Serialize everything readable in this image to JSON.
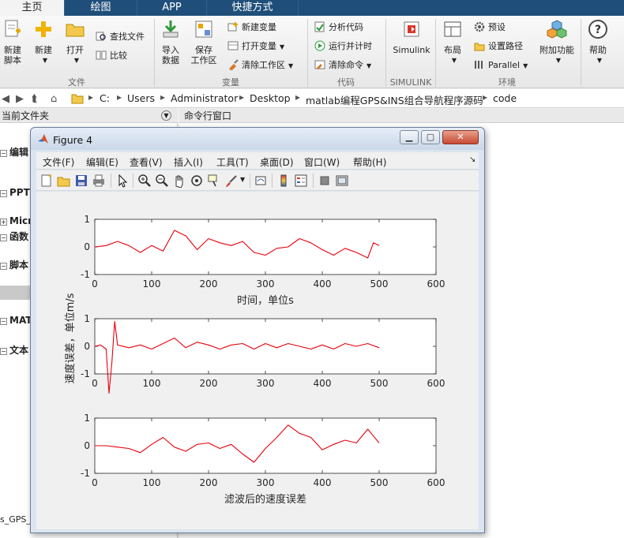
{
  "ribbon_tabs": [
    "主页",
    "绘图",
    "APP",
    "快捷方式"
  ],
  "ribbon": {
    "file_group": "文件",
    "new_script": [
      "新建",
      "脚本"
    ],
    "new": "新建",
    "open": "打开",
    "find_files": "查找文件",
    "compare": "比较",
    "variable_group": "变量",
    "import_data": [
      "导入",
      "数据"
    ],
    "save_workspace": [
      "保存",
      "工作区"
    ],
    "new_variable": "新建变量",
    "open_variable": "打开变量",
    "clear_workspace": "清除工作区",
    "code_group": "代码",
    "analyze_code": "分析代码",
    "run_and_time": "运行并计时",
    "clear_commands": "清除命令",
    "simulink_group": "SIMULINK",
    "simulink": "Simulink",
    "environment_group": "环境",
    "layout": "布局",
    "preferences": "预设",
    "set_path": "设置路径",
    "parallel": "Parallel",
    "addons": "附加功能",
    "help": "帮助"
  },
  "address": {
    "crumbs": [
      "C:",
      "Users",
      "Administrator",
      "Desktop",
      "matlab编程GPS&INS组合导航程序源码",
      "code"
    ]
  },
  "panes": {
    "current_folder": "当前文件夹",
    "command_window": "命令行窗口",
    "tree": [
      "编辑",
      "PPT",
      "Micr",
      "函数",
      "脚本",
      "MAT",
      "文本"
    ],
    "bottom_file": "s_GPS_"
  },
  "figure": {
    "title": "Figure 4",
    "menus": [
      "文件(F)",
      "编辑(E)",
      "查看(V)",
      "插入(I)",
      "工具(T)",
      "桌面(D)",
      "窗口(W)",
      "帮助(H)"
    ],
    "ylabel": "速度误差，单位m/s",
    "colors": {
      "line": "#e8000b"
    }
  },
  "chart_data": [
    {
      "type": "line",
      "xlabel": "时间，单位s",
      "ylabel": "",
      "xlim": [
        0,
        600
      ],
      "ylim": [
        -1,
        1
      ],
      "xticks": [
        0,
        100,
        200,
        300,
        400,
        500,
        600
      ],
      "yticks": [
        -1,
        0,
        1
      ],
      "x": [
        0,
        20,
        40,
        60,
        80,
        100,
        120,
        140,
        160,
        180,
        200,
        220,
        240,
        260,
        280,
        300,
        320,
        340,
        360,
        380,
        400,
        420,
        440,
        460,
        480,
        490,
        500
      ],
      "y": [
        0,
        0.05,
        0.2,
        0.05,
        -0.2,
        0.05,
        -0.15,
        0.6,
        0.4,
        -0.1,
        0.3,
        0.15,
        0.05,
        0.2,
        -0.2,
        -0.3,
        -0.05,
        0.0,
        0.3,
        0.15,
        -0.1,
        -0.3,
        -0.05,
        -0.2,
        -0.4,
        0.15,
        0.05
      ]
    },
    {
      "type": "line",
      "xlabel": "",
      "ylabel": "",
      "xlim": [
        0,
        600
      ],
      "ylim": [
        -1,
        1
      ],
      "xticks": [
        0,
        100,
        200,
        300,
        400,
        500,
        600
      ],
      "yticks": [
        -1,
        0,
        1
      ],
      "x": [
        0,
        10,
        20,
        25,
        30,
        35,
        40,
        60,
        80,
        100,
        120,
        140,
        160,
        180,
        200,
        220,
        240,
        260,
        280,
        300,
        320,
        340,
        360,
        380,
        400,
        420,
        440,
        460,
        480,
        500
      ],
      "y": [
        0,
        0.05,
        -0.1,
        -1.7,
        -0.6,
        0.9,
        0.05,
        -0.05,
        0.05,
        -0.1,
        0.1,
        0.3,
        -0.05,
        0.15,
        0.05,
        -0.1,
        0.05,
        0.1,
        -0.1,
        0.1,
        -0.05,
        0.1,
        0.0,
        -0.1,
        0.05,
        -0.1,
        0.1,
        0.0,
        0.1,
        -0.05
      ]
    },
    {
      "type": "line",
      "xlabel": "滤波后的速度误差",
      "ylabel": "",
      "xlim": [
        0,
        600
      ],
      "ylim": [
        -1,
        1
      ],
      "xticks": [
        0,
        100,
        200,
        300,
        400,
        500,
        600
      ],
      "yticks": [
        -1,
        0,
        1
      ],
      "x": [
        0,
        20,
        40,
        60,
        80,
        100,
        120,
        140,
        160,
        180,
        200,
        220,
        240,
        260,
        280,
        300,
        320,
        340,
        360,
        380,
        400,
        420,
        440,
        460,
        480,
        490,
        500
      ],
      "y": [
        0,
        0.0,
        -0.05,
        -0.1,
        -0.25,
        0.05,
        0.3,
        -0.05,
        -0.2,
        0.05,
        0.1,
        -0.1,
        0.05,
        -0.3,
        -0.6,
        -0.1,
        0.3,
        0.75,
        0.45,
        0.3,
        -0.15,
        0.05,
        0.2,
        0.1,
        0.6,
        0.35,
        0.1
      ]
    }
  ]
}
